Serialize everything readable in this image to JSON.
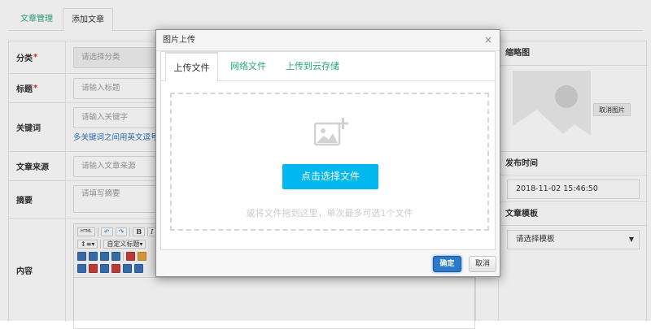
{
  "tabs": [
    {
      "label": "文章管理"
    },
    {
      "label": "添加文章"
    }
  ],
  "form": {
    "category": {
      "label": "分类",
      "placeholder": "请选择分类"
    },
    "title": {
      "label": "标题",
      "placeholder": "请输入标题"
    },
    "keywords": {
      "label": "关键词",
      "placeholder": "请输入关键字",
      "hint": "多关键词之间用英文逗号"
    },
    "source": {
      "label": "文章来源",
      "placeholder": "请输入文章来源"
    },
    "summary": {
      "label": "摘要",
      "placeholder": "请填写摘要"
    },
    "content": {
      "label": "内容"
    }
  },
  "editor_toolbar": {
    "html_label": "HTML",
    "bold": "B",
    "italic": "I",
    "heading_select": "自定义标题"
  },
  "right_panel": {
    "thumbnail_title": "缩略图",
    "cancel_image": "取消图片",
    "publish_time_title": "发布时间",
    "publish_time_value": "2018-11-02 15:46:50",
    "template_title": "文章模板",
    "template_placeholder": "请选择模板"
  },
  "modal": {
    "title": "图片上传",
    "close_symbol": "×",
    "tabs": [
      {
        "label": "上传文件"
      },
      {
        "label": "网络文件"
      },
      {
        "label": "上传到云存储"
      }
    ],
    "pick_button": "点击选择文件",
    "drop_hint": "或将文件拖到这里，单次最多可选1个文件",
    "ok_button": "确定",
    "cancel_button": "取消"
  },
  "colors": {
    "accent_green": "#2aa87a",
    "pick_button_blue": "#00b7ee",
    "ok_button_blue": "#2a79cb",
    "required_red": "#e0292c"
  }
}
